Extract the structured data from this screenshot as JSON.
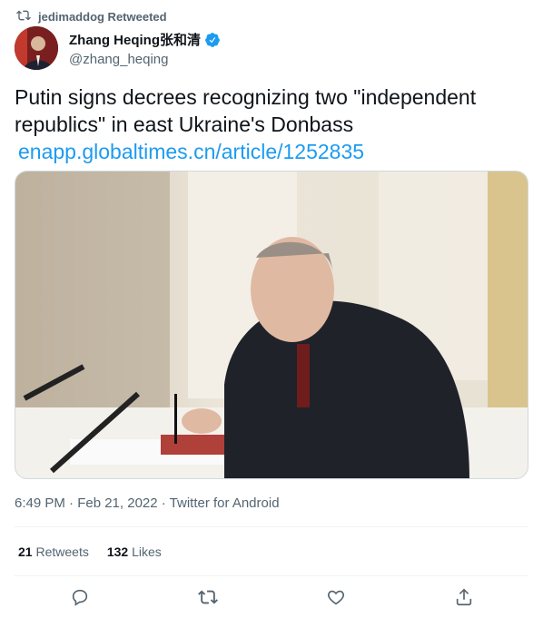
{
  "retweet_context": {
    "text": "jedimaddog Retweeted"
  },
  "author": {
    "name": "Zhang Heqing张和清",
    "handle": "@zhang_heqing",
    "verified": true
  },
  "tweet": {
    "text": "Putin signs decrees recognizing two \"independent republics\" in east Ukraine's Donbass",
    "link": "enapp.globaltimes.cn/article/1252835"
  },
  "meta": {
    "line": "6:49 PM · Feb 21, 2022 · Twitter for Android"
  },
  "stats": {
    "retweets_count": "21",
    "retweets_label": "Retweets",
    "likes_count": "132",
    "likes_label": "Likes"
  },
  "icons": {
    "retweet_context": "retweet-icon",
    "verified": "verified-badge-icon",
    "reply": "reply-icon",
    "retweet": "retweet-icon",
    "like": "heart-icon",
    "share": "share-icon"
  },
  "colors": {
    "link": "#1d9bf0",
    "secondary_text": "#536471",
    "verified": "#1d9bf0"
  }
}
